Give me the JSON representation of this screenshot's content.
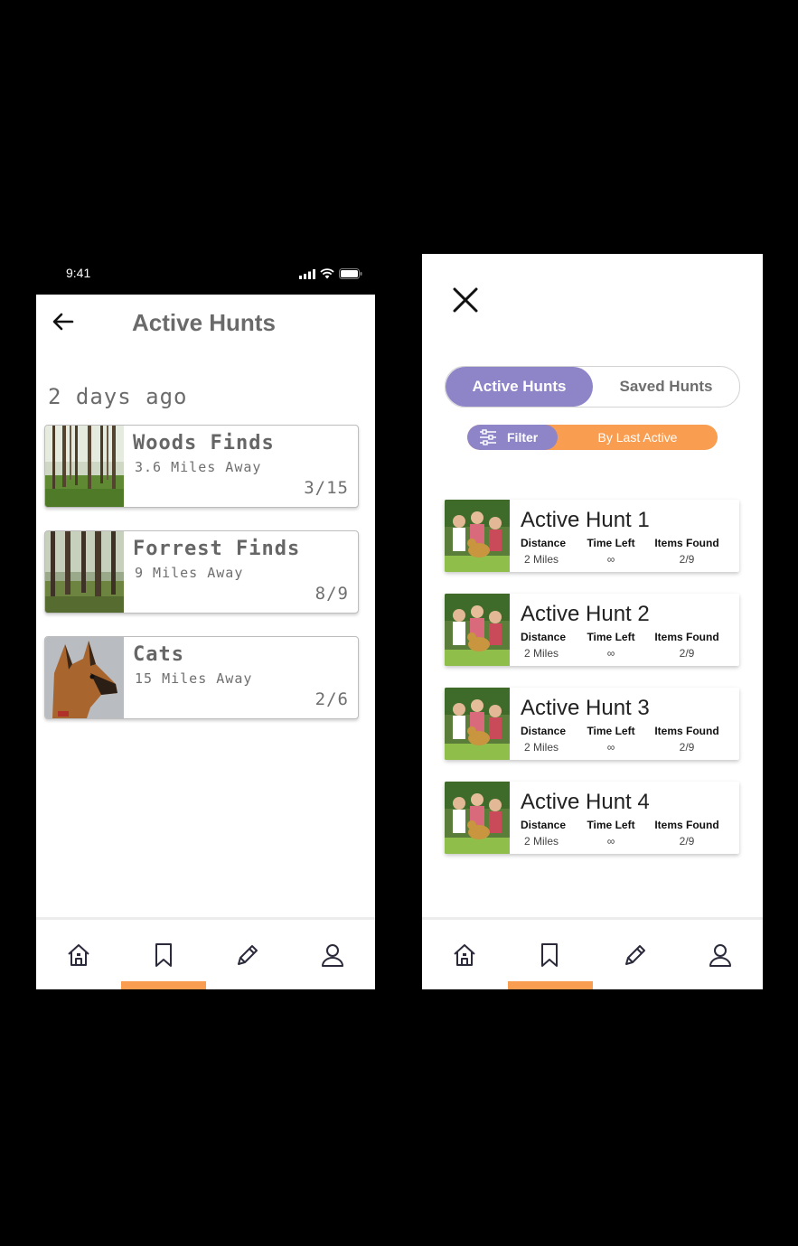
{
  "status_bar": {
    "time": "9:41"
  },
  "left": {
    "title": "Active Hunts",
    "section_label": "2 days ago",
    "hunts": [
      {
        "name": "Woods Finds",
        "distance": "3.6 Miles Away",
        "progress": "3/15"
      },
      {
        "name": "Forrest Finds",
        "distance": "9 Miles Away",
        "progress": "8/9"
      },
      {
        "name": "Cats",
        "distance": "15 Miles Away",
        "progress": "2/6"
      }
    ]
  },
  "right": {
    "tabs": {
      "active": "Active Hunts",
      "saved": "Saved Hunts"
    },
    "filter": {
      "label": "Filter",
      "sort": "By Last Active"
    },
    "hunts": [
      {
        "name": "Active Hunt 1",
        "distance_label": "Distance",
        "distance": "2 Miles",
        "time_label": "Time Left",
        "time": "∞",
        "found_label": "Items Found",
        "found": "2/9"
      },
      {
        "name": "Active Hunt 2",
        "distance_label": "Distance",
        "distance": "2 Miles",
        "time_label": "Time Left",
        "time": "∞",
        "found_label": "Items Found",
        "found": "2/9"
      },
      {
        "name": "Active Hunt 3",
        "distance_label": "Distance",
        "distance": "2 Miles",
        "time_label": "Time Left",
        "time": "∞",
        "found_label": "Items Found",
        "found": "2/9"
      },
      {
        "name": "Active Hunt 4",
        "distance_label": "Distance",
        "distance": "2 Miles",
        "time_label": "Time Left",
        "time": "∞",
        "found_label": "Items Found",
        "found": "2/9"
      }
    ]
  },
  "nav": {
    "items": [
      "home-icon",
      "bookmark-icon",
      "pencil-icon",
      "profile-icon"
    ],
    "active_index": 1
  },
  "colors": {
    "accent": "#8d85c8",
    "highlight": "#f99d50",
    "text_gray": "#6a6a6a"
  }
}
